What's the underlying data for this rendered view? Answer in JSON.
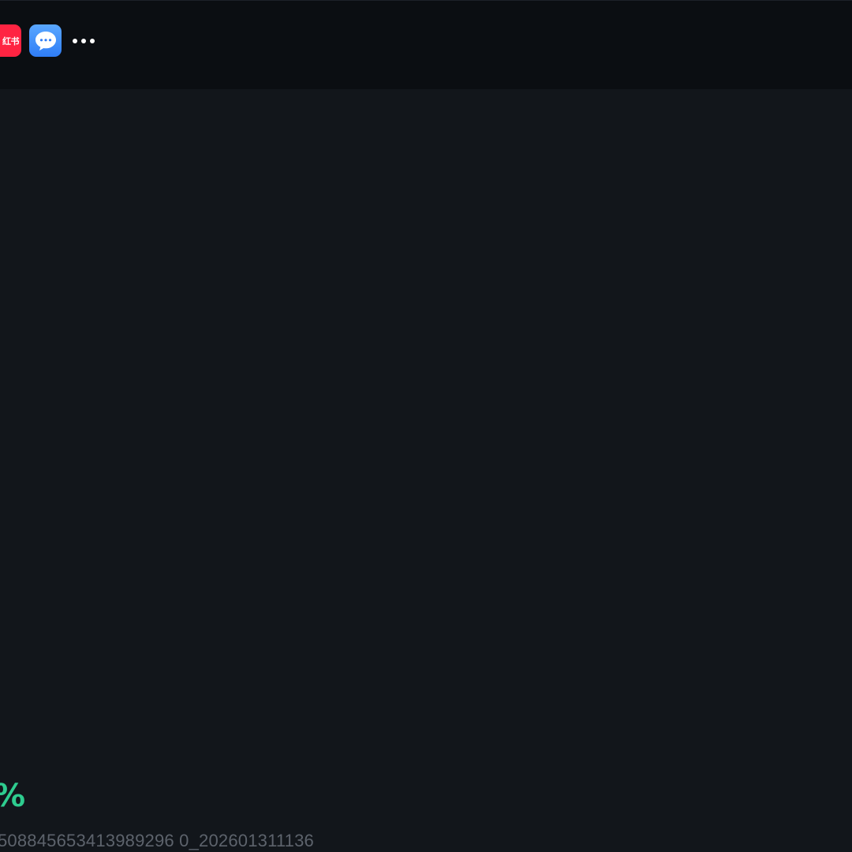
{
  "share_bar": {
    "apps": [
      {
        "name": "xiaohongshu",
        "label": "红书",
        "color": "#ff2442",
        "icon": "xiaohongshu-icon"
      },
      {
        "name": "messages",
        "color": "#2f7df6",
        "icon": "chat-bubble-icon"
      }
    ],
    "more_icon": "more-dots-icon"
  },
  "footer": {
    "percent_text": "%",
    "percent_color": "#2ecc8f",
    "id_text": "508845653413989296 0_202601311136"
  }
}
